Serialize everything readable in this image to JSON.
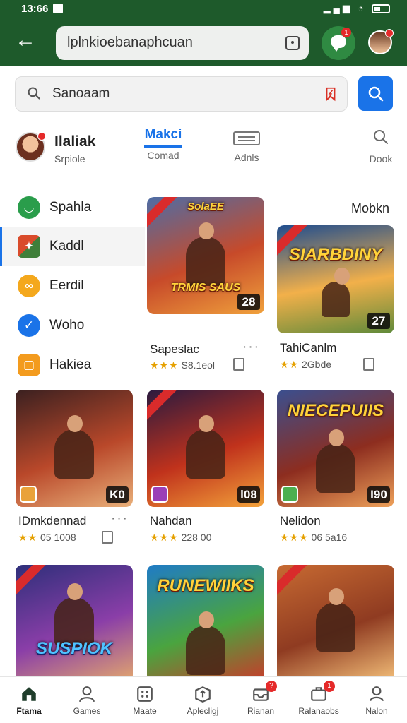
{
  "status_bar": {
    "time": "13:66"
  },
  "top_bar": {
    "url": "lplnkioebanaphcuan",
    "chat_badge": "1"
  },
  "search": {
    "value": "Sanoaam"
  },
  "profile": {
    "name": "Ilaliak",
    "subtitle": "Srpiole"
  },
  "tabs": [
    {
      "title": "Makci",
      "label": "Comad",
      "active": true
    },
    {
      "label": "Adnls",
      "icon": "list-icon"
    },
    {
      "label": "Dook",
      "icon": "search-icon"
    }
  ],
  "sidebar": {
    "items": [
      {
        "label": "Spahla",
        "icon": "android-icon",
        "color": "#2a9d4b"
      },
      {
        "label": "Kaddl",
        "icon": "game-board-icon",
        "color": "#3f7f3a",
        "active": true
      },
      {
        "label": "Eerdil",
        "icon": "yellow-loop-icon",
        "color": "#f4a81d"
      },
      {
        "label": "Woho",
        "icon": "check-icon",
        "color": "#1a73e8"
      },
      {
        "label": "Hakiea",
        "icon": "orange-square-icon",
        "color": "#f39b1e"
      }
    ]
  },
  "section_title": "Mobkn",
  "games": [
    {
      "thumb_title": "TRMIS SAUS",
      "thumb_top": "SolaEE",
      "score": "28",
      "name": "Sapeslac",
      "rating": "S8.1eol",
      "stars": "★★★",
      "colors": [
        "#4d6da6",
        "#c74a2a",
        "#f0a13c"
      ]
    },
    {
      "thumb_title": "SIARBDINY",
      "thumb_top": "",
      "score": "27",
      "name": "TahiCanlm",
      "rating": "2Gbde",
      "stars": "★★",
      "colors": [
        "#1f4d8f",
        "#f2b04a",
        "#5f8a3a"
      ]
    },
    {
      "thumb_title": "",
      "thumb_top": "",
      "score": "K0",
      "name": "IDmkdennad",
      "rating": "05 1008",
      "stars": "★★",
      "colors": [
        "#3a2020",
        "#b9482a",
        "#e9b07a"
      ]
    },
    {
      "thumb_title": "",
      "thumb_top": "",
      "score": "l08",
      "name": "Nahdan",
      "rating": "228 00",
      "stars": "★★★",
      "colors": [
        "#2a1a3f",
        "#c0321c",
        "#f3a23a"
      ]
    },
    {
      "thumb_title": "NIECEPUIIS",
      "thumb_top": "",
      "score": "I90",
      "name": "Nelidon",
      "rating": "06 5a16",
      "stars": "★★★",
      "colors": [
        "#3a4f8f",
        "#8d2d1f",
        "#eea15a"
      ]
    },
    {
      "thumb_title": "SUSPIOK",
      "thumb_top": "",
      "score": "",
      "name": "",
      "rating": "",
      "stars": "",
      "colors": [
        "#2e2f7a",
        "#8a3ea8",
        "#e3a76d"
      ]
    },
    {
      "thumb_title": "RUNEWIIKS",
      "thumb_top": "",
      "score": "",
      "name": "",
      "rating": "",
      "stars": "",
      "colors": [
        "#1f7bc6",
        "#4aa43f",
        "#c93a2a"
      ]
    },
    {
      "thumb_title": "",
      "thumb_top": "",
      "score": "",
      "name": "",
      "rating": "",
      "stars": "",
      "colors": [
        "#c76a32",
        "#8f3b21",
        "#f4c07a"
      ]
    }
  ],
  "bottom_nav": [
    {
      "label": "Ftama",
      "icon": "home-icon",
      "active": true
    },
    {
      "label": "Games",
      "icon": "person-icon"
    },
    {
      "label": "Maate",
      "icon": "grid-icon"
    },
    {
      "label": "Aplecligj",
      "icon": "box-icon"
    },
    {
      "label": "Rianan",
      "icon": "inbox-icon",
      "badge": "?"
    },
    {
      "label": "Ralanaobs",
      "icon": "briefcase-icon",
      "badge": "1"
    },
    {
      "label": "Nalon",
      "icon": "profile-icon"
    }
  ],
  "colors": {
    "top_bar": "#1e5a2b",
    "accent": "#1a73e8",
    "badge": "#e52a2a",
    "star": "#e5a000"
  }
}
